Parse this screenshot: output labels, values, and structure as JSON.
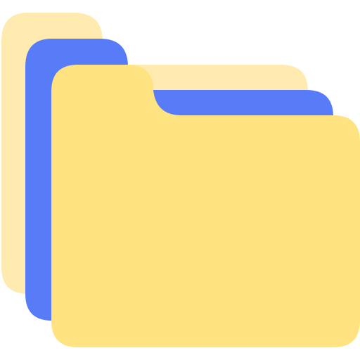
{
  "icon": {
    "name": "stacked-folders-icon",
    "layers": [
      {
        "name": "back-folder",
        "color": "#FFEBAF"
      },
      {
        "name": "middle-folder",
        "color": "#587CF8"
      },
      {
        "name": "front-folder",
        "color": "#FFE380"
      }
    ]
  }
}
